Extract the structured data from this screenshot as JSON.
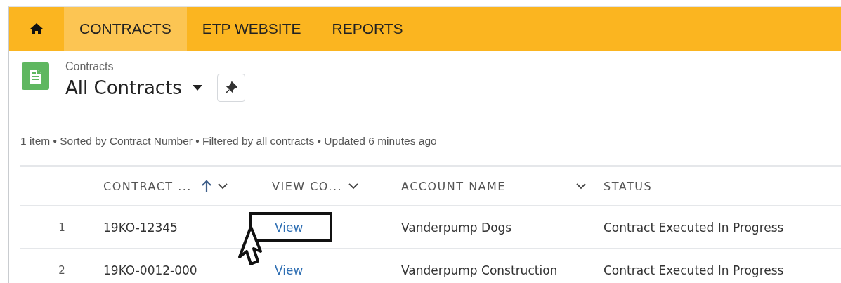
{
  "nav": {
    "items": [
      {
        "label": "CONTRACTS",
        "selected": true
      },
      {
        "label": "ETP WEBSITE",
        "selected": false
      },
      {
        "label": "REPORTS",
        "selected": false
      }
    ]
  },
  "header": {
    "object_name": "Contracts",
    "list_view": "All Contracts"
  },
  "list_info": "1 item • Sorted by Contract Number • Filtered by all contracts • Updated 6 minutes ago",
  "table": {
    "columns": [
      {
        "label": "CONTRACT ...",
        "sorted": true,
        "menu": true
      },
      {
        "label": "VIEW CO...",
        "sorted": false,
        "menu": true
      },
      {
        "label": "ACCOUNT NAME",
        "sorted": false,
        "menu": true
      },
      {
        "label": "STATUS",
        "sorted": false,
        "menu": false
      }
    ],
    "rows": [
      {
        "number": "1",
        "cells": [
          "19KO-12345",
          "View",
          "Vanderpump Dogs",
          "Contract Executed In Progress"
        ],
        "highlighted": true
      },
      {
        "number": "2",
        "cells": [
          "19KO-0012-000",
          "View",
          "Vanderpump Construction",
          "Contract Executed In Progress"
        ],
        "highlighted": false
      }
    ]
  }
}
